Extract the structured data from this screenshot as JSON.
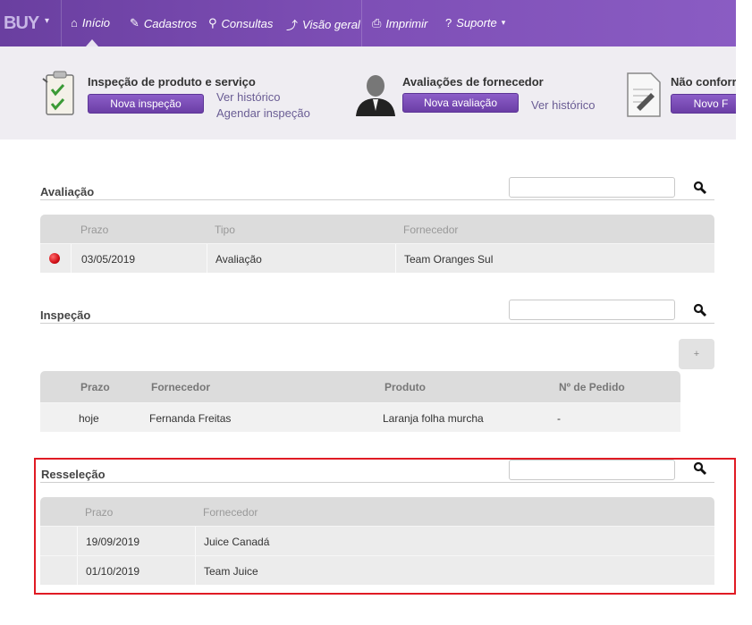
{
  "nav": {
    "brand": "BUY",
    "items": [
      {
        "label": "Início",
        "icon": "home-icon"
      },
      {
        "label": "Cadastros",
        "icon": "pencil-icon"
      },
      {
        "label": "Consultas",
        "icon": "search-icon"
      },
      {
        "label": "Visão geral",
        "icon": "chart-icon"
      },
      {
        "label": "Imprimir",
        "icon": "printer-icon"
      },
      {
        "label": "Suporte",
        "icon": "help-icon"
      }
    ],
    "accent": "#7b4cb3"
  },
  "quick": {
    "inspection": {
      "title": "Inspeção de produto e serviço",
      "button": "Nova inspeção",
      "link_history": "Ver histórico",
      "link_schedule": "Agendar inspeção"
    },
    "supplier": {
      "title": "Avaliações de fornecedor",
      "button": "Nova avaliação",
      "link_history": "Ver histórico"
    },
    "nonconformity": {
      "title": "Não conforr",
      "button": "Novo F"
    }
  },
  "avaliacao": {
    "title": "Avaliação",
    "headers": [
      "Prazo",
      "Tipo",
      "Fornecedor"
    ],
    "rows": [
      {
        "prazo": "03/05/2019",
        "tipo": "Avaliação",
        "fornecedor": "Team Oranges Sul",
        "status_color": "#e01b24"
      }
    ]
  },
  "inspecao": {
    "title": "Inspeção",
    "add_button": "+",
    "headers": [
      "Prazo",
      "Fornecedor",
      "Produto",
      "Nº de Pedido"
    ],
    "rows": [
      {
        "prazo": "hoje",
        "fornecedor": "Fernanda Freitas",
        "produto": "Laranja folha murcha",
        "pedido": "-"
      }
    ]
  },
  "resselecao": {
    "title": "Resseleção",
    "headers": [
      "Prazo",
      "Fornecedor"
    ],
    "rows": [
      {
        "prazo": "19/09/2019",
        "fornecedor": "Juice Canadá"
      },
      {
        "prazo": "01/10/2019",
        "fornecedor": "Team Juice"
      }
    ],
    "highlight_color": "#e01b24"
  }
}
